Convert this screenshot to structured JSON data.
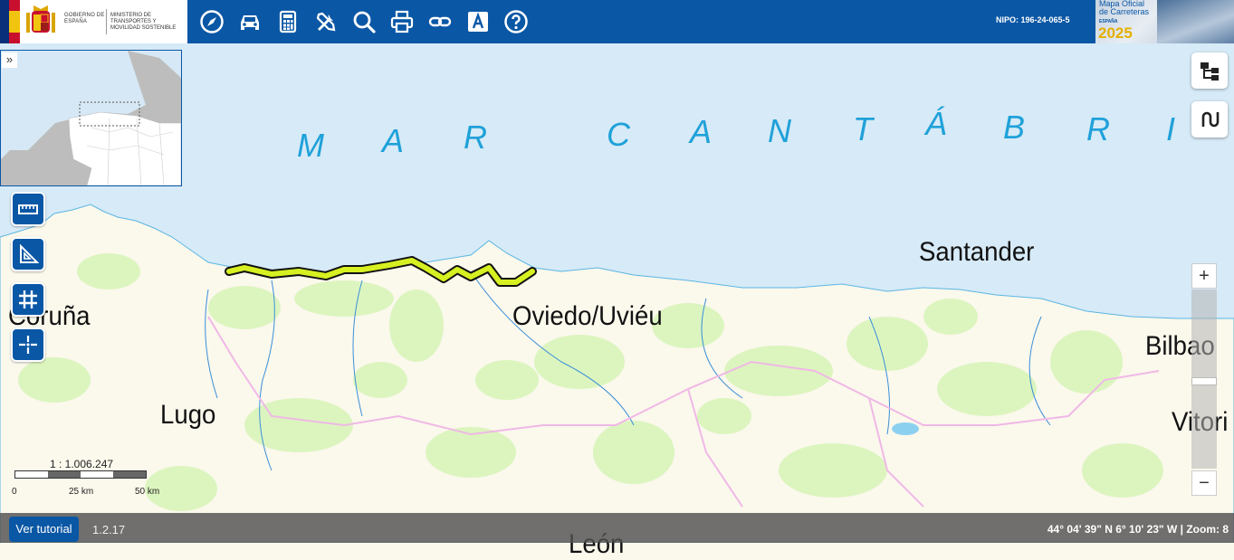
{
  "header": {
    "gov_label": "GOBIERNO DE ESPAÑA",
    "ministry_label": "MINISTERIO DE TRANSPORTES Y MOVILIDAD SOSTENIBLE",
    "nipo": "NIPO: 196-24-065-5",
    "map_logo": {
      "line1": "Mapa Oficial",
      "line2": "de Carreteras",
      "country": "ESPAÑA",
      "year": "2025"
    },
    "toolbar": [
      "compass-icon",
      "car-icon",
      "calculator-icon",
      "tools-icon",
      "search-icon",
      "print-icon",
      "link-icon",
      "font-icon",
      "help-icon"
    ]
  },
  "map": {
    "sea_label_letters": [
      "M",
      "A",
      "R",
      "C",
      "A",
      "N",
      "T",
      "Á",
      "B",
      "R",
      "I"
    ],
    "cities": [
      {
        "name": "Santander"
      },
      {
        "name": "Oviedo/Uviéu"
      },
      {
        "name": "Coruña"
      },
      {
        "name": "Bilbao"
      },
      {
        "name": "Lugo"
      },
      {
        "name": "Vitori"
      },
      {
        "name": "León"
      }
    ],
    "overview_toggle": "»",
    "scale": {
      "ratio": "1 : 1.006.247",
      "labels": [
        "0",
        "25 km",
        "50 km"
      ]
    },
    "zoom": {
      "plus": "+",
      "minus": "−"
    }
  },
  "footer": {
    "tutorial_button": "Ver tutorial",
    "version": "1.2.17",
    "coordinates": "44° 04' 39\" N 6° 10' 23\" W |",
    "zoom_label": "Zoom: 8"
  },
  "colors": {
    "brand_blue": "#0a57a5",
    "sea": "#d6eaf7",
    "land": "#fbf8ec",
    "forest": "#d9f5b8",
    "route": "#d6f021"
  }
}
